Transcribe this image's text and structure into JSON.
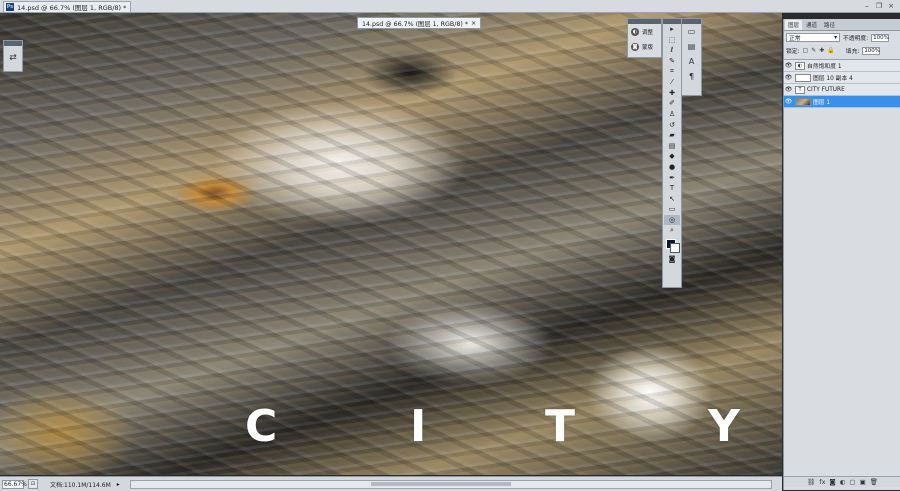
{
  "app": {
    "logo": "Ps"
  },
  "document": {
    "tab_title": "14.psd @ 66.7% (图层 1, RGB/8) *",
    "window_title": "14.psd @ 66.7% (图层 1, RGB/8) *",
    "close_glyph": "×"
  },
  "window_controls": {
    "minimize": "–",
    "restore": "❐",
    "close": "×"
  },
  "canvas_text": {
    "letters": [
      "C",
      "I",
      "T",
      "Y"
    ]
  },
  "mini_panel": {
    "items": [
      {
        "label": "调整",
        "icon": "adjust-icon"
      },
      {
        "label": "蒙版",
        "icon": "mask-icon"
      }
    ]
  },
  "toolbox": {
    "tools": [
      {
        "name": "move-tool",
        "glyph": "▸"
      },
      {
        "name": "marquee-tool",
        "glyph": "⬚"
      },
      {
        "name": "lasso-tool",
        "glyph": "ℓ"
      },
      {
        "name": "quick-select-tool",
        "glyph": "✎"
      },
      {
        "name": "crop-tool",
        "glyph": "⌗"
      },
      {
        "name": "eyedropper-tool",
        "glyph": "⁄"
      },
      {
        "name": "healing-tool",
        "glyph": "✚"
      },
      {
        "name": "brush-tool",
        "glyph": "✐"
      },
      {
        "name": "stamp-tool",
        "glyph": "♙"
      },
      {
        "name": "history-brush-tool",
        "glyph": "↺"
      },
      {
        "name": "eraser-tool",
        "glyph": "▰"
      },
      {
        "name": "gradient-tool",
        "glyph": "▤"
      },
      {
        "name": "blur-tool",
        "glyph": "◆"
      },
      {
        "name": "dodge-tool",
        "glyph": "●"
      },
      {
        "name": "pen-tool",
        "glyph": "✒"
      },
      {
        "name": "type-tool",
        "glyph": "T"
      },
      {
        "name": "path-select-tool",
        "glyph": "↖"
      },
      {
        "name": "shape-tool",
        "glyph": "▭"
      },
      {
        "name": "3d-rotate-tool",
        "glyph": "◎"
      },
      {
        "name": "zoom-tool",
        "glyph": "⌕"
      }
    ],
    "extra": {
      "swap": "↰",
      "quick_mask": "◙"
    }
  },
  "dock": {
    "icons": [
      "▭",
      "▤",
      "A",
      "¶"
    ]
  },
  "layers": {
    "tabs": [
      "图层",
      "通道",
      "路径"
    ],
    "blend_mode": "正常",
    "opacity_label": "不透明度:",
    "opacity_value": "100%",
    "lock_label": "锁定:",
    "fill_label": "填充:",
    "fill_value": "100%",
    "items": [
      {
        "name": "自然饱和度 1",
        "thumb": "◐",
        "kind": "adjustment",
        "selected": false
      },
      {
        "name": "图层 10 副本 4",
        "thumb": "",
        "kind": "pixel",
        "selected": false
      },
      {
        "name": "CITY FUTURE",
        "thumb": "T",
        "kind": "text",
        "selected": false
      },
      {
        "name": "图层 1",
        "thumb": "",
        "kind": "image",
        "selected": true
      }
    ],
    "footer_icons": [
      "⛓",
      "fx",
      "◙",
      "◐",
      "▢",
      "▣",
      "🗑"
    ]
  },
  "status": {
    "zoom": "66.67%",
    "doc_info": "文档:110.1M/114.6M",
    "arrow": "▸"
  }
}
